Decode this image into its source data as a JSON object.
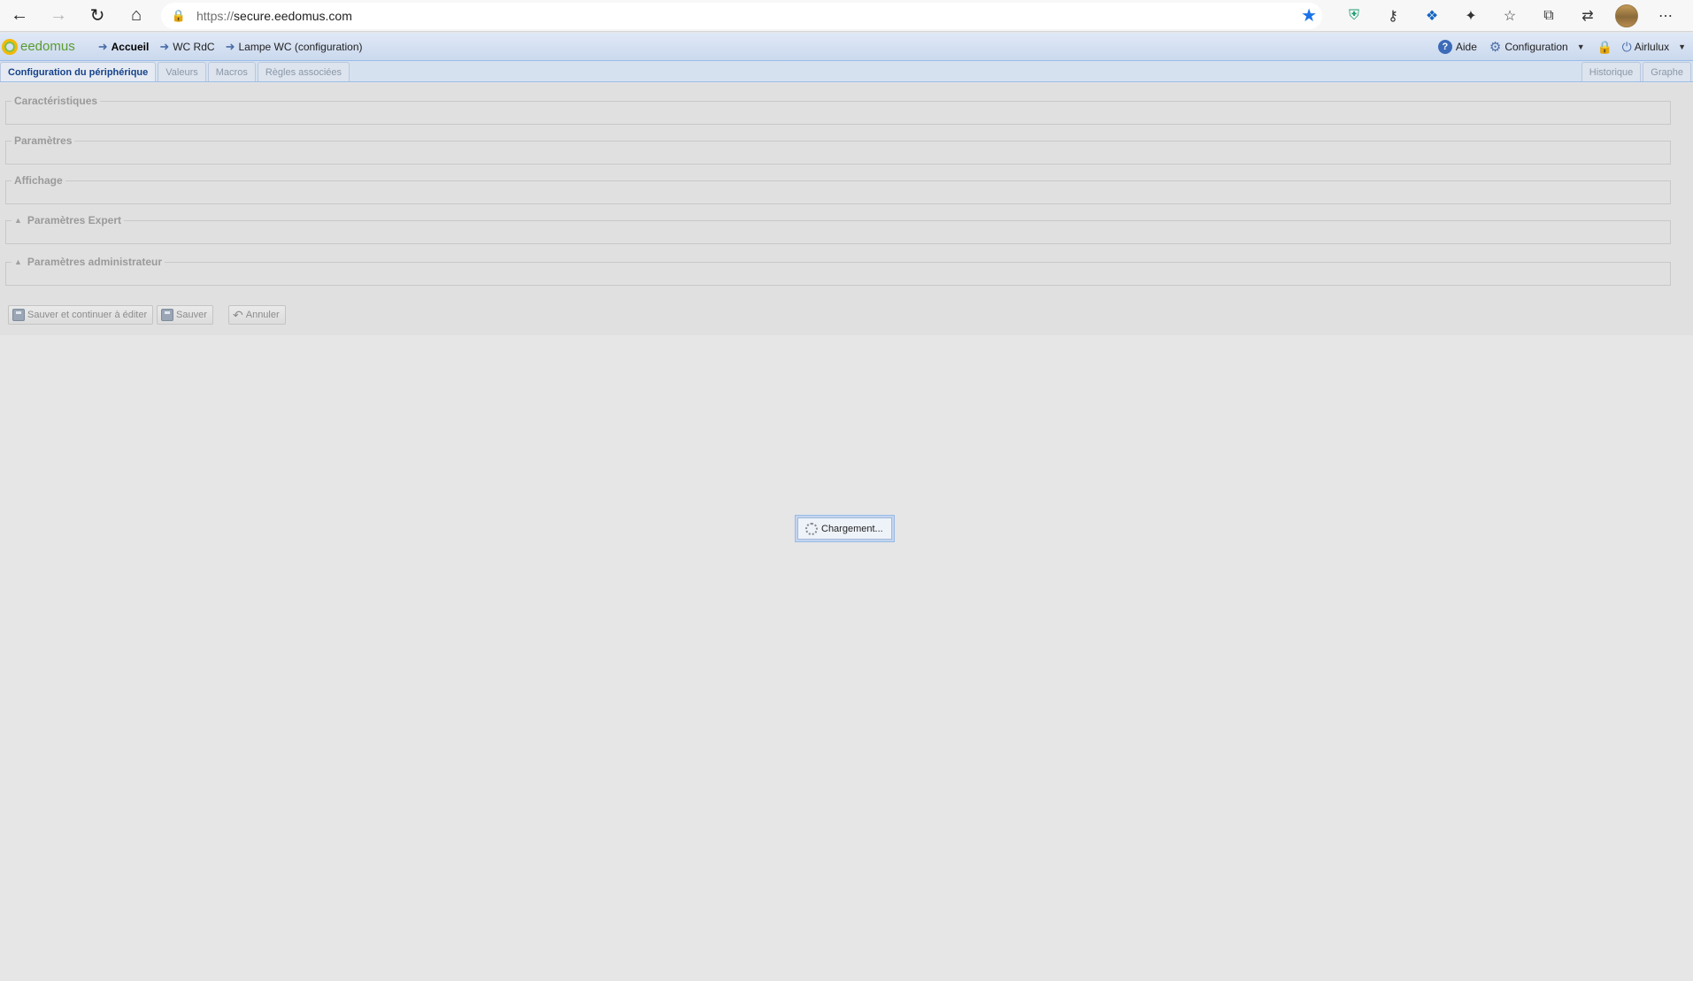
{
  "browser": {
    "url_scheme": "https://",
    "url_host": "secure.eedomus.com",
    "icons": {
      "back": "arrow-left",
      "forward": "arrow-right",
      "reload": "reload",
      "home": "home",
      "lock": "lock",
      "favorite": "star",
      "extensions": [
        "shield",
        "key",
        "gecko",
        "puzzle",
        "favorites",
        "collections",
        "sync"
      ],
      "menu": "ellipsis"
    }
  },
  "app": {
    "logo": "eedomus",
    "breadcrumbs": [
      {
        "label": "Accueil"
      },
      {
        "label": "WC RdC"
      },
      {
        "label": "Lampe WC (configuration)"
      }
    ],
    "header_right": {
      "help": "Aide",
      "configuration": "Configuration",
      "user": "Airlulux"
    }
  },
  "tabs": {
    "left": [
      "Configuration du périphérique",
      "Valeurs",
      "Macros",
      "Règles associées"
    ],
    "right": [
      "Historique",
      "Graphe"
    ],
    "active": "Configuration du périphérique"
  },
  "form": {
    "sections": [
      "Caractéristiques",
      "Paramètres",
      "Affichage",
      "Paramètres Expert",
      "Paramètres administrateur"
    ],
    "buttons": {
      "save_continue": "Sauver et continuer à éditer",
      "save": "Sauver",
      "cancel": "Annuler"
    }
  },
  "loading": {
    "text": "Chargement..."
  },
  "colors": {
    "accent": "#15428b",
    "header_bg": "#dfe8f6",
    "favorite_star": "#1a73e8"
  }
}
